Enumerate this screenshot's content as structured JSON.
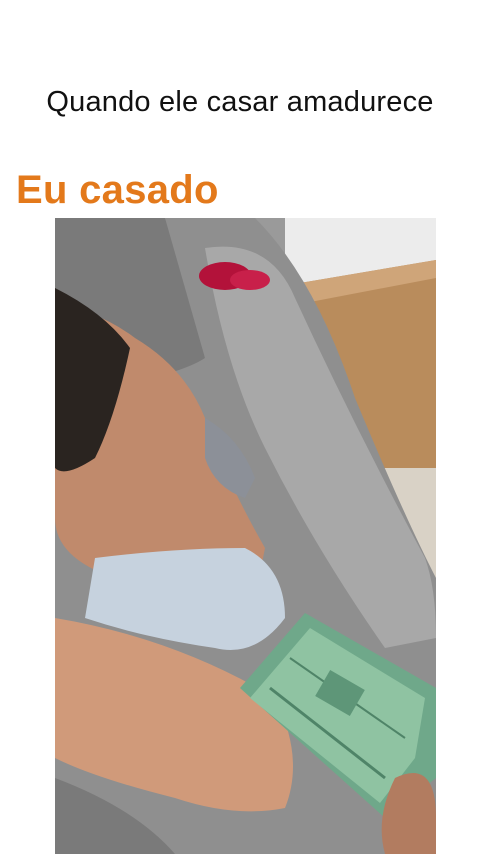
{
  "meme": {
    "caption": "Quando ele casar amadurece",
    "subtitle": "Eu casado",
    "subtitle_color": "#e3791b"
  },
  "video": {
    "frame_description_icon": "video-frame"
  }
}
